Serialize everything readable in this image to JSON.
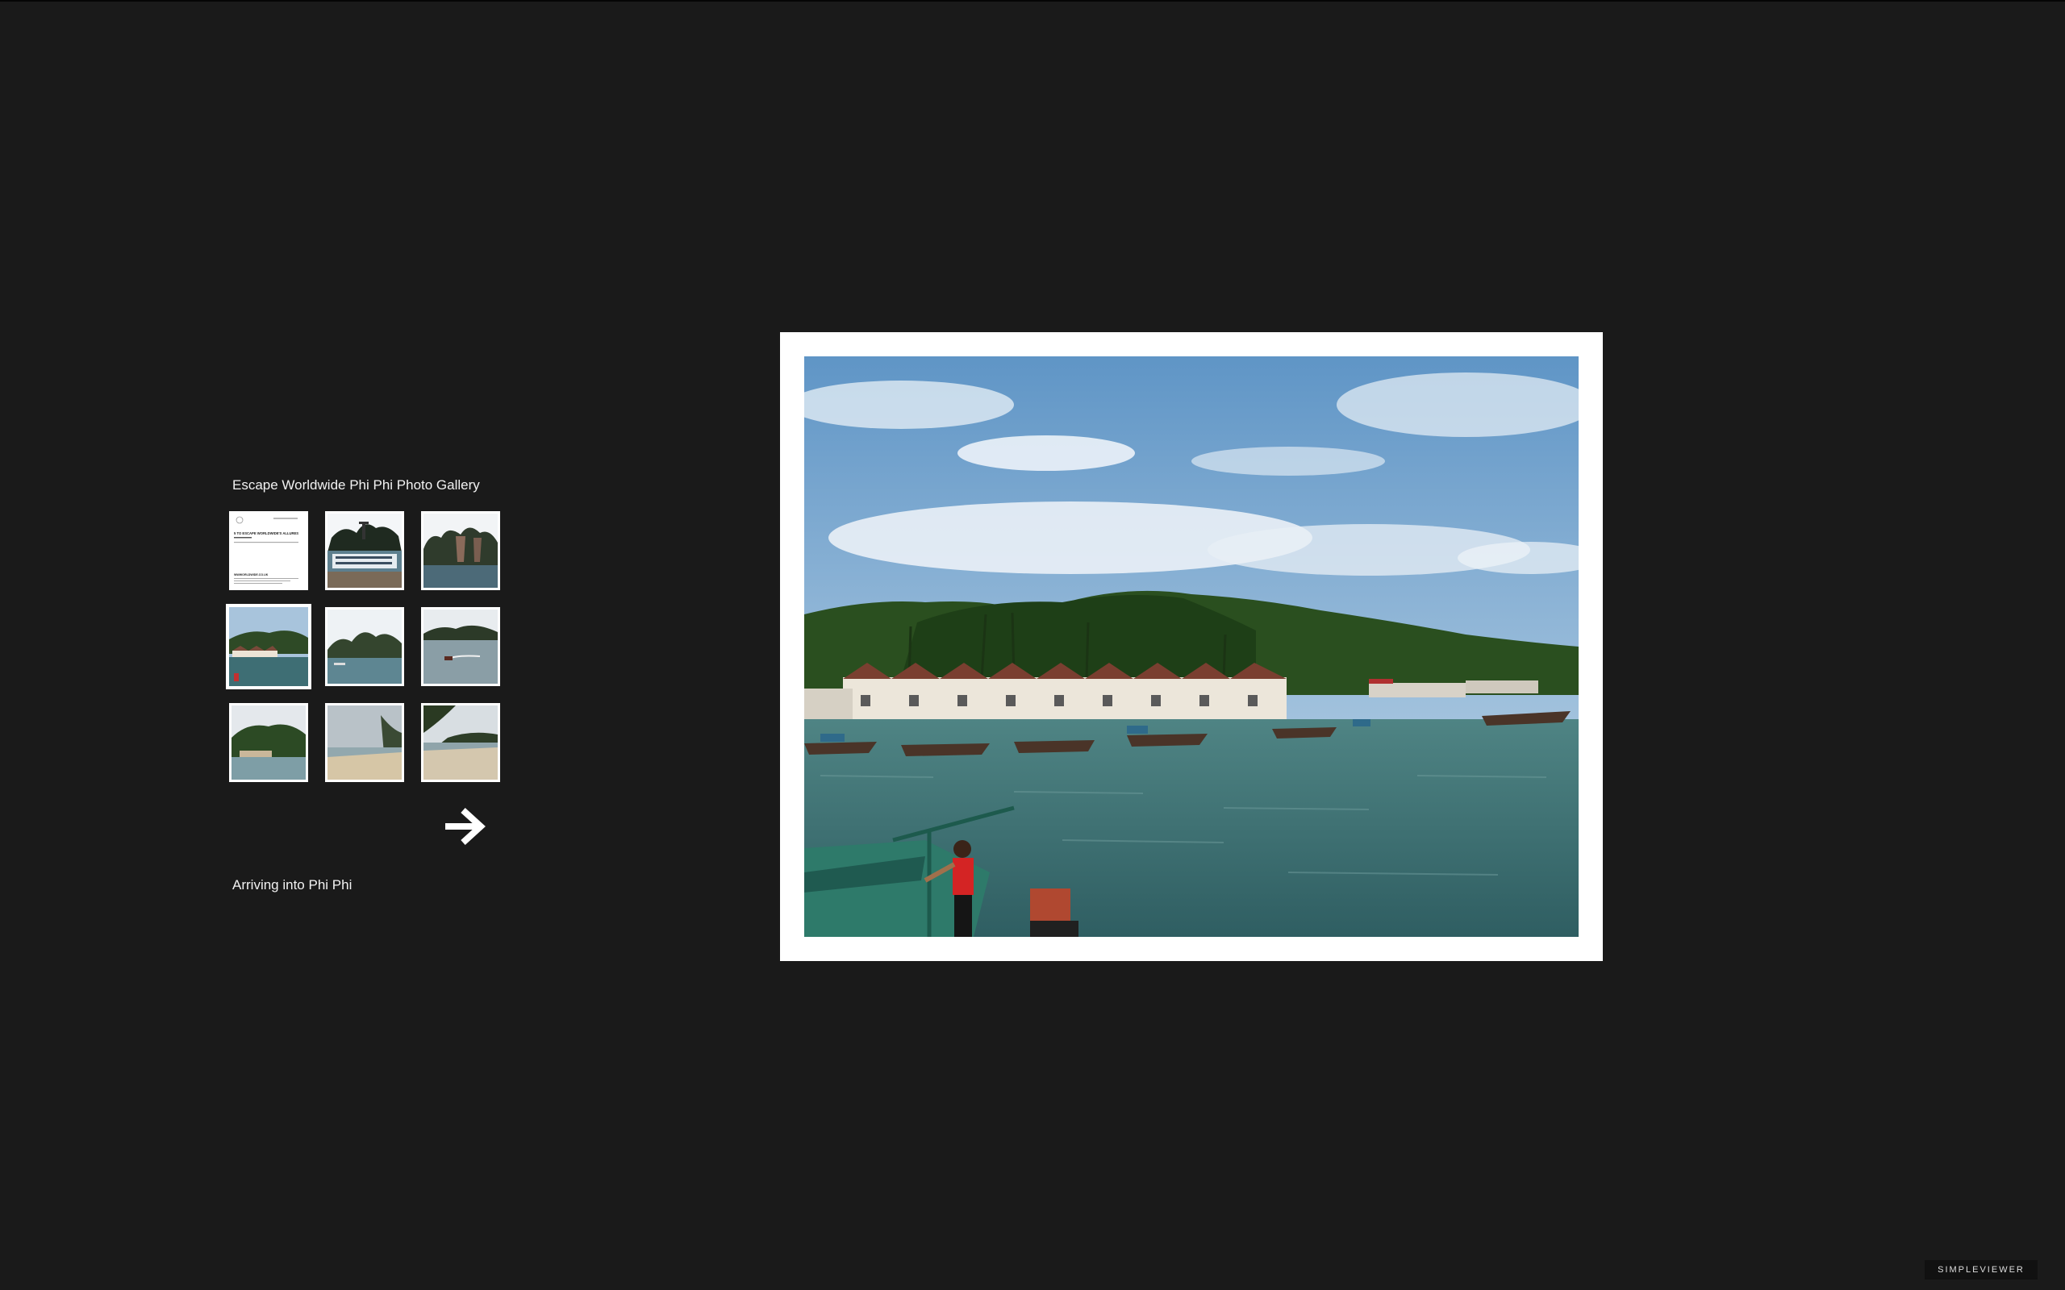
{
  "gallery": {
    "title": "Escape Worldwide Phi Phi Photo Gallery",
    "caption": "Arriving into Phi Phi",
    "selected_index": 3,
    "thumbnails": [
      {
        "kind": "document",
        "doc_title": "5 TO ESCAPE WORLDWIDE'S ALLURES",
        "doc_footer": "WWWORLDWIDE.CO.UK"
      },
      {
        "kind": "ferry-harbour"
      },
      {
        "kind": "limestone-cliffs"
      },
      {
        "kind": "bungalows-waterfront"
      },
      {
        "kind": "island-bay"
      },
      {
        "kind": "speedboat-sea"
      },
      {
        "kind": "village-shore"
      },
      {
        "kind": "sandy-beach-cloudy"
      },
      {
        "kind": "beach-treeline"
      }
    ]
  },
  "navigation": {
    "next_icon": "arrow-right-icon"
  },
  "viewer": {
    "image_subject": "pier-bungalows-longtail-boats"
  },
  "branding": {
    "label": "SIMPLEVIEWER"
  },
  "colors": {
    "background": "#1a1a1a",
    "frame": "#ffffff",
    "text": "#f2f2f2"
  }
}
